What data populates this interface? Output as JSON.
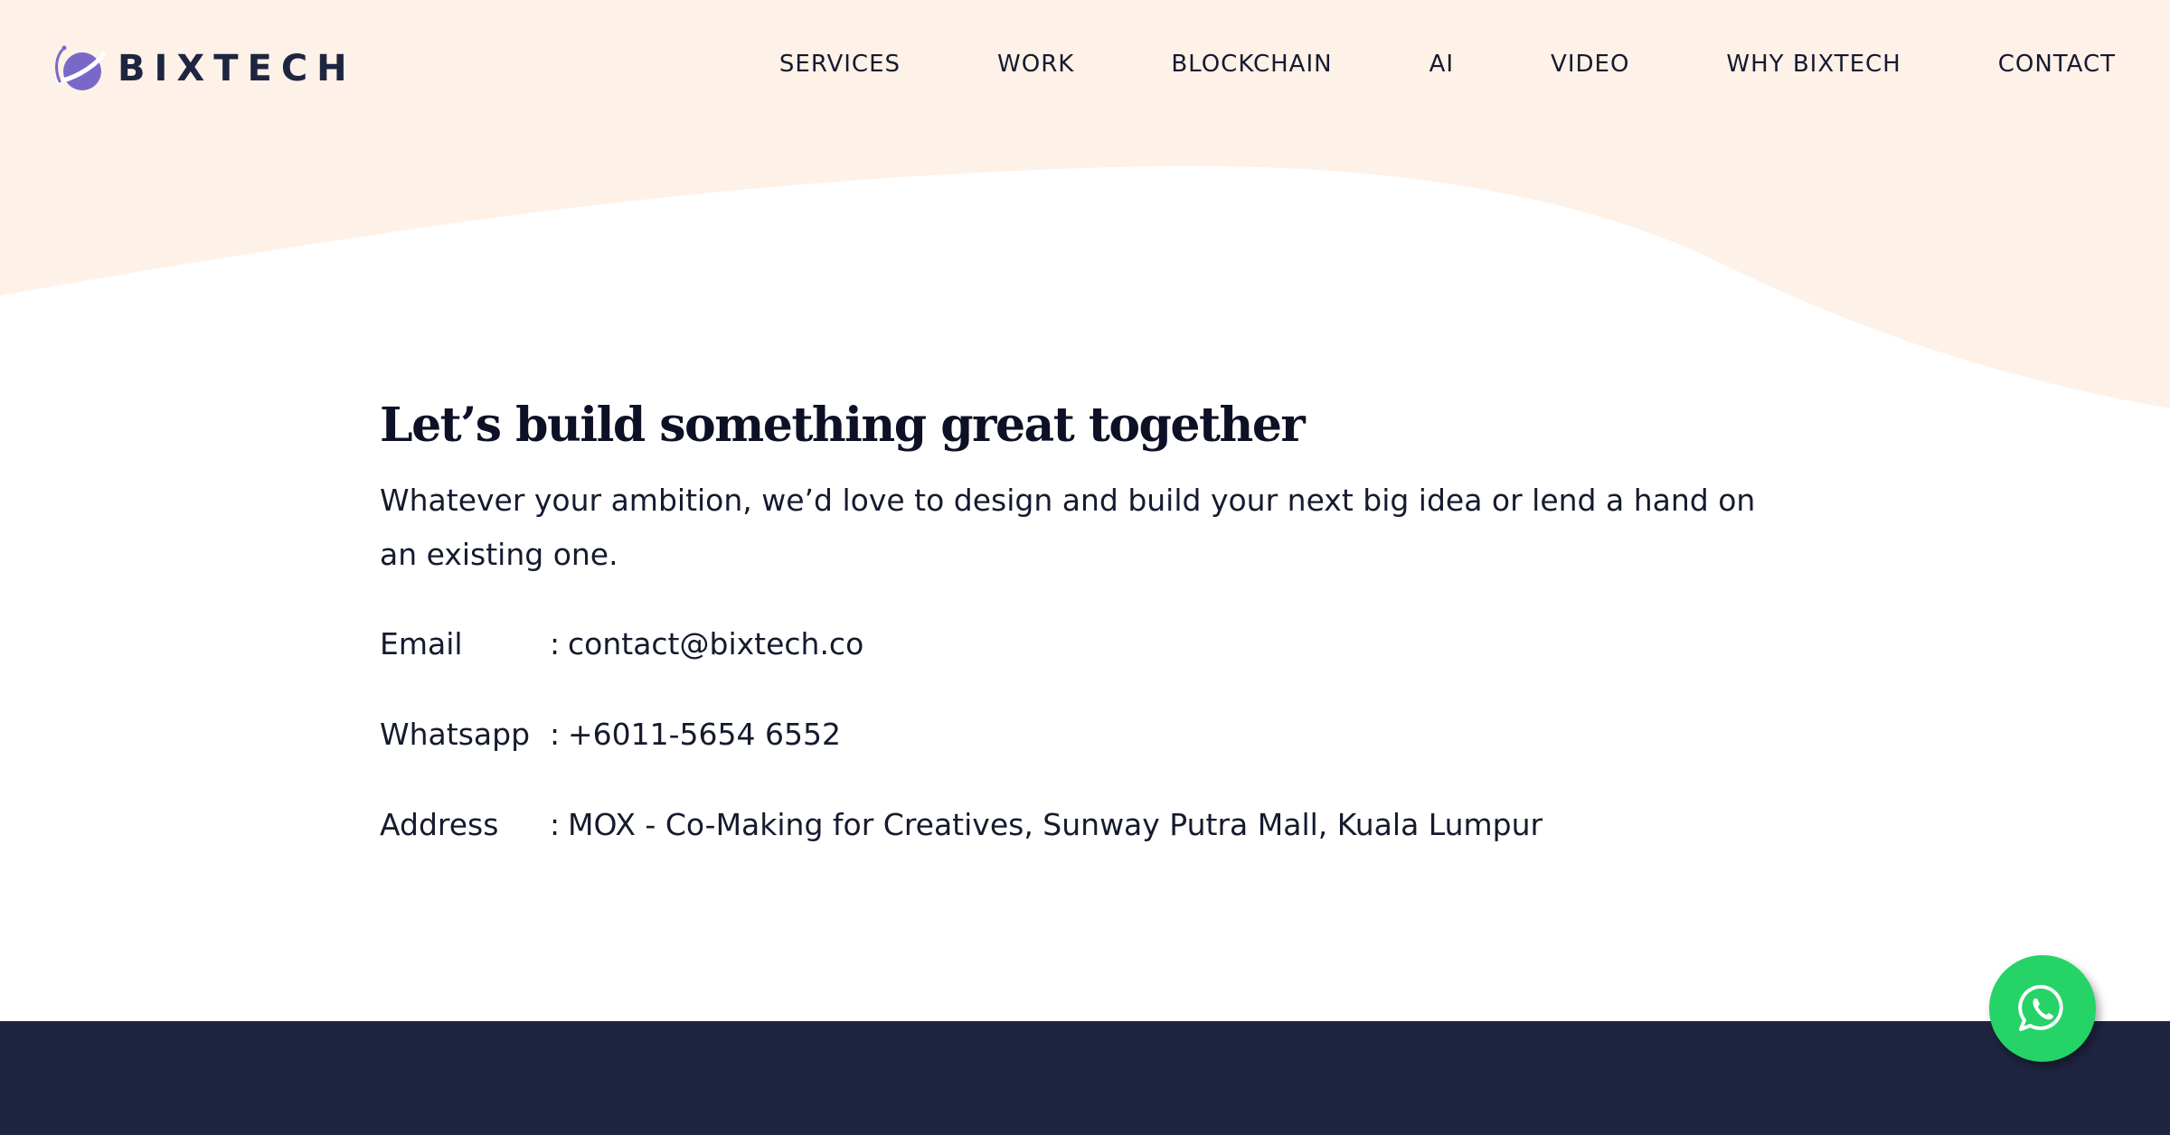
{
  "brand": {
    "name": "BIXTECH",
    "icon": "planet-logo-icon",
    "colors": {
      "logo": "#7a68c9",
      "text": "#1e2540"
    }
  },
  "nav": {
    "items": [
      {
        "label": "SERVICES"
      },
      {
        "label": "WORK"
      },
      {
        "label": "BLOCKCHAIN"
      },
      {
        "label": "AI"
      },
      {
        "label": "VIDEO"
      },
      {
        "label": "WHY BIXTECH"
      },
      {
        "label": "CONTACT"
      }
    ]
  },
  "main": {
    "heading": "Let’s build something great together",
    "lead": "Whatever your ambition, we’d love to design and build your next big idea or lend a hand on an existing one.",
    "contacts": [
      {
        "label": "Email",
        "separator": ":",
        "value": "contact@bixtech.co"
      },
      {
        "label": "Whatsapp",
        "separator": ":",
        "value": "+6011-5654 6552"
      },
      {
        "label": "Address",
        "separator": ":",
        "value": "MOX - Co-Making for Creatives, Sunway Putra Mall, Kuala Lumpur"
      }
    ]
  },
  "whatsapp_button": {
    "icon": "whatsapp-icon",
    "color": "#25d366"
  },
  "colors": {
    "hero_background": "#fef1e8",
    "page_background": "#ffffff",
    "footer_background": "#1f2540",
    "text": "#151a2e"
  }
}
